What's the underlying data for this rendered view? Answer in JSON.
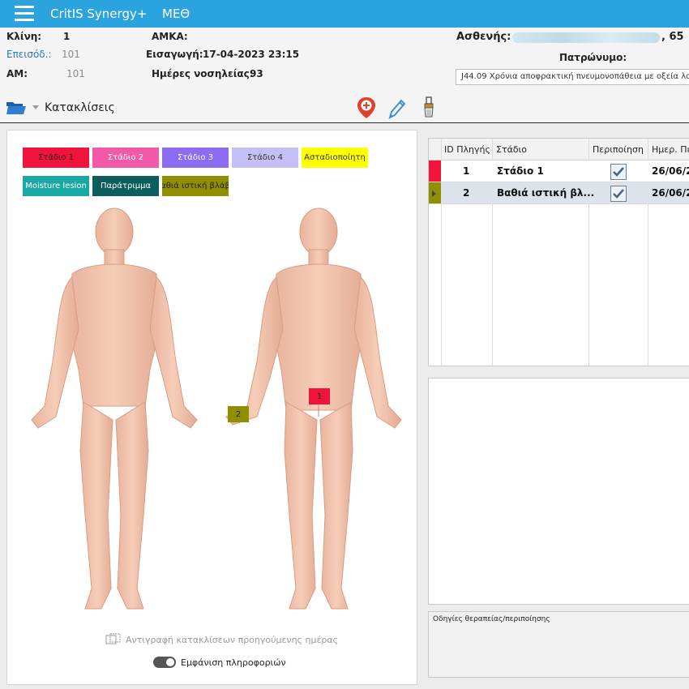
{
  "app": {
    "title": "CritIS Synergy+",
    "unit": "ΜΕΘ"
  },
  "header": {
    "bed_label": "Κλίνη:",
    "bed_value": "1",
    "episode_label": "Επεισόδ.:",
    "episode_value": "101",
    "am_label": "ΑΜ:",
    "am_value": "101",
    "amka_label": "ΑΜΚΑ:",
    "admission_label": "Εισαγωγή:",
    "admission_value": "17-04-2023 23:15",
    "days_label": "Ημέρες νοσηλείας:",
    "days_value": "93",
    "patient_label": "Ασθενής:",
    "patient_age": ", 65",
    "father_label": "Πατρώνυμο:",
    "diagnosis": "J44.09 Χρόνια αποφρακτική πνευμονοπάθεια με οξεία λο"
  },
  "section": {
    "title": "Κατακλίσεις"
  },
  "legend": [
    {
      "label": "Στάδιο 1",
      "bg": "#f0143c",
      "fg": "#222222"
    },
    {
      "label": "Στάδιο 2",
      "bg": "#f25aa8",
      "fg": "#ffffff"
    },
    {
      "label": "Στάδιο 3",
      "bg": "#8c6cf2",
      "fg": "#ffffff"
    },
    {
      "label": "Στάδιο 4",
      "bg": "#c4c0f5",
      "fg": "#333333"
    },
    {
      "label": "Ασταδιοποίητη",
      "bg": "#ffff00",
      "fg": "#333333"
    },
    {
      "label": "Moisture lesion",
      "bg": "#1aa8a2",
      "fg": "#ffffff"
    },
    {
      "label": "Παράτριμμα",
      "bg": "#0b5e5c",
      "fg": "#ffffff"
    },
    {
      "label": "αθιά ιστική βλάβ",
      "bg": "#8f8f00",
      "fg": "#222222"
    }
  ],
  "markers": [
    {
      "label": "1",
      "bg": "#f0143c"
    },
    {
      "label": "2",
      "bg": "#8f8f00"
    }
  ],
  "copy_label": "Αντιγραφή κατακλίσεων προηγούμενης ημέρας",
  "toggle_label": "Εμφάνιση πληροφοριών",
  "grid": {
    "headers": [
      "ID Πληγής",
      "Στάδιο",
      "Περιποίηση",
      "Ημερ. Πε"
    ],
    "rows": [
      {
        "id": "1",
        "stage": "Στάδιο 1",
        "care": true,
        "date": "26/06/2",
        "color": "#f0143c"
      },
      {
        "id": "2",
        "stage": "Βαθιά ιστική βλ...",
        "care": true,
        "date": "26/06/2",
        "color": "#8f8f00"
      }
    ]
  },
  "notes_label": "Οδηγίες θεραπείας/περιποίησης"
}
